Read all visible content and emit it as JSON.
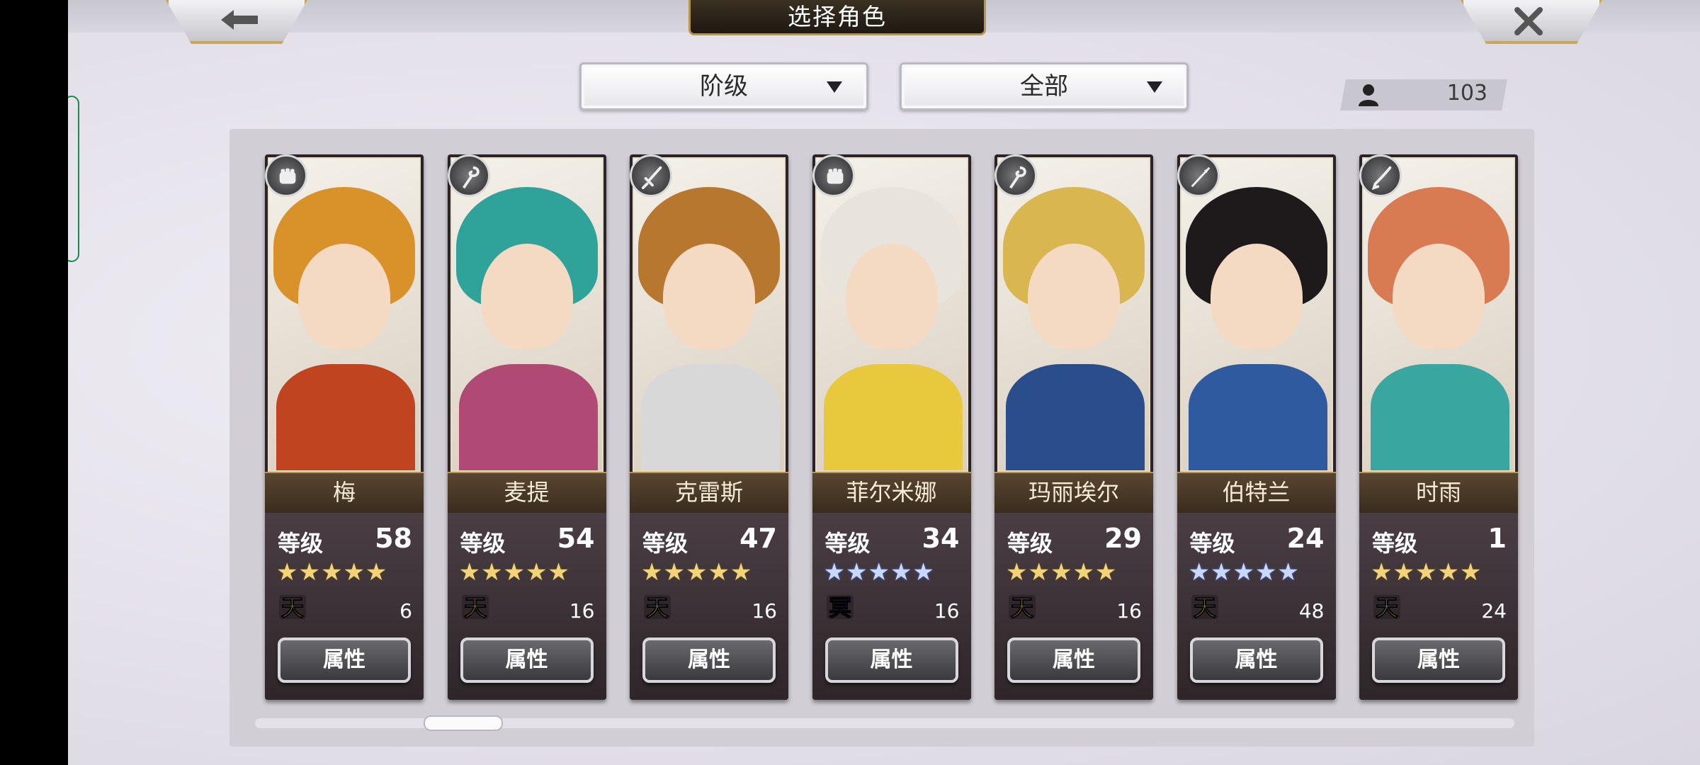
{
  "header": {
    "title": "选择角色"
  },
  "filters": {
    "rank": "阶级",
    "group": "全部"
  },
  "roster_count": "103",
  "common": {
    "level_label": "等级",
    "attr_button": "属性"
  },
  "characters": [
    {
      "name": "梅",
      "level": "58",
      "stars": "★★★★★",
      "star_color": "gold",
      "element": "天",
      "element_color": "#f4d02a",
      "count": "6",
      "hair": "#d9922a",
      "body": "#c0441f",
      "class_icon": "fist-icon"
    },
    {
      "name": "麦提",
      "level": "54",
      "stars": "★★★★★",
      "star_color": "gold",
      "element": "天",
      "element_color": "#f4d02a",
      "count": "16",
      "hair": "#2fa39a",
      "body": "#b04a74",
      "class_icon": "staff-icon"
    },
    {
      "name": "克雷斯",
      "level": "47",
      "stars": "★★★★★",
      "star_color": "gold",
      "element": "天",
      "element_color": "#f4d02a",
      "count": "16",
      "hair": "#b8772e",
      "body": "#d8d8d8",
      "class_icon": "sword-icon"
    },
    {
      "name": "菲尔米娜",
      "level": "34",
      "stars": "★★★★★",
      "star_color": "blue",
      "element": "冥",
      "element_color": "#2a3aa8",
      "count": "16",
      "hair": "#e8e4dc",
      "body": "#e8c83c",
      "class_icon": "fist-icon"
    },
    {
      "name": "玛丽埃尔",
      "level": "29",
      "stars": "★★★★★",
      "star_color": "gold",
      "element": "天",
      "element_color": "#f4d02a",
      "count": "16",
      "hair": "#d9b650",
      "body": "#2a4d8c",
      "class_icon": "staff-icon"
    },
    {
      "name": "伯特兰",
      "level": "24",
      "stars": "★★★★★",
      "star_color": "blue",
      "element": "天",
      "element_color": "#f4d02a",
      "count": "48",
      "hair": "#1e1a1c",
      "body": "#2f5aa0",
      "class_icon": "spear-icon"
    },
    {
      "name": "时雨",
      "level": "1",
      "stars": "★★★★★",
      "star_color": "gold",
      "element": "天",
      "element_color": "#f4d02a",
      "count": "24",
      "hair": "#d87a52",
      "body": "#3aa6a0",
      "class_icon": "blade-icon"
    }
  ]
}
